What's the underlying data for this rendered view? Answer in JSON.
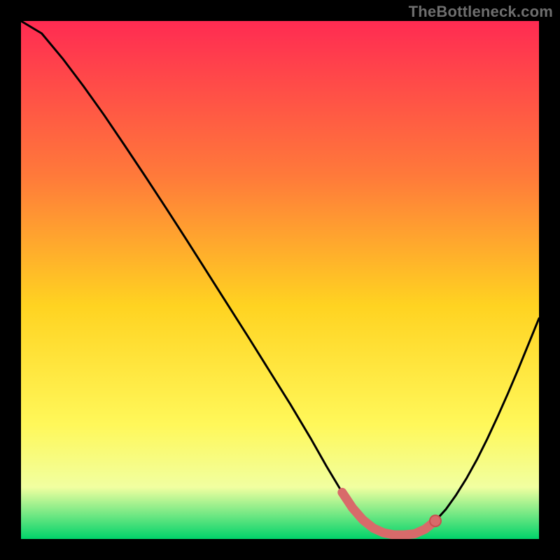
{
  "watermark": "TheBottleneck.com",
  "colors": {
    "grad_top": "#ff2b52",
    "grad_mid_upper": "#ff7a3a",
    "grad_mid": "#ffd321",
    "grad_mid_lower": "#fff85a",
    "grad_lower": "#f1ffa0",
    "grad_bottom": "#00d36a",
    "curve": "#000000",
    "marker_fill": "#d86a6a",
    "marker_stroke": "#c84f4f"
  },
  "chart_data": {
    "type": "line",
    "title": "",
    "xlabel": "",
    "ylabel": "",
    "xlim": [
      0,
      100
    ],
    "ylim": [
      0,
      100
    ],
    "series": [
      {
        "name": "bottleneck-curve",
        "x": [
          0,
          4,
          8,
          12,
          16,
          20,
          24,
          28,
          32,
          36,
          40,
          44,
          48,
          52,
          56,
          59,
          62,
          64,
          66,
          68,
          70,
          72,
          74,
          76,
          78,
          80,
          82,
          84,
          86,
          88,
          90,
          92,
          94,
          96,
          98,
          100
        ],
        "y": [
          100,
          97.6,
          92.8,
          87.5,
          81.9,
          76.0,
          70.0,
          63.9,
          57.7,
          51.4,
          45.1,
          38.8,
          32.4,
          26.0,
          19.3,
          14.0,
          9.0,
          6.0,
          3.7,
          2.1,
          1.2,
          0.8,
          0.8,
          1.0,
          1.9,
          3.5,
          5.7,
          8.5,
          11.7,
          15.3,
          19.3,
          23.6,
          28.1,
          32.8,
          37.7,
          42.6
        ]
      }
    ],
    "highlight_segment": {
      "x": [
        62,
        64,
        66,
        68,
        70,
        72,
        74,
        76,
        78,
        80
      ],
      "y": [
        9.0,
        6.0,
        3.7,
        2.1,
        1.2,
        0.8,
        0.8,
        1.0,
        1.9,
        3.5
      ]
    },
    "highlight_point": {
      "x": 80,
      "y": 3.5
    }
  }
}
